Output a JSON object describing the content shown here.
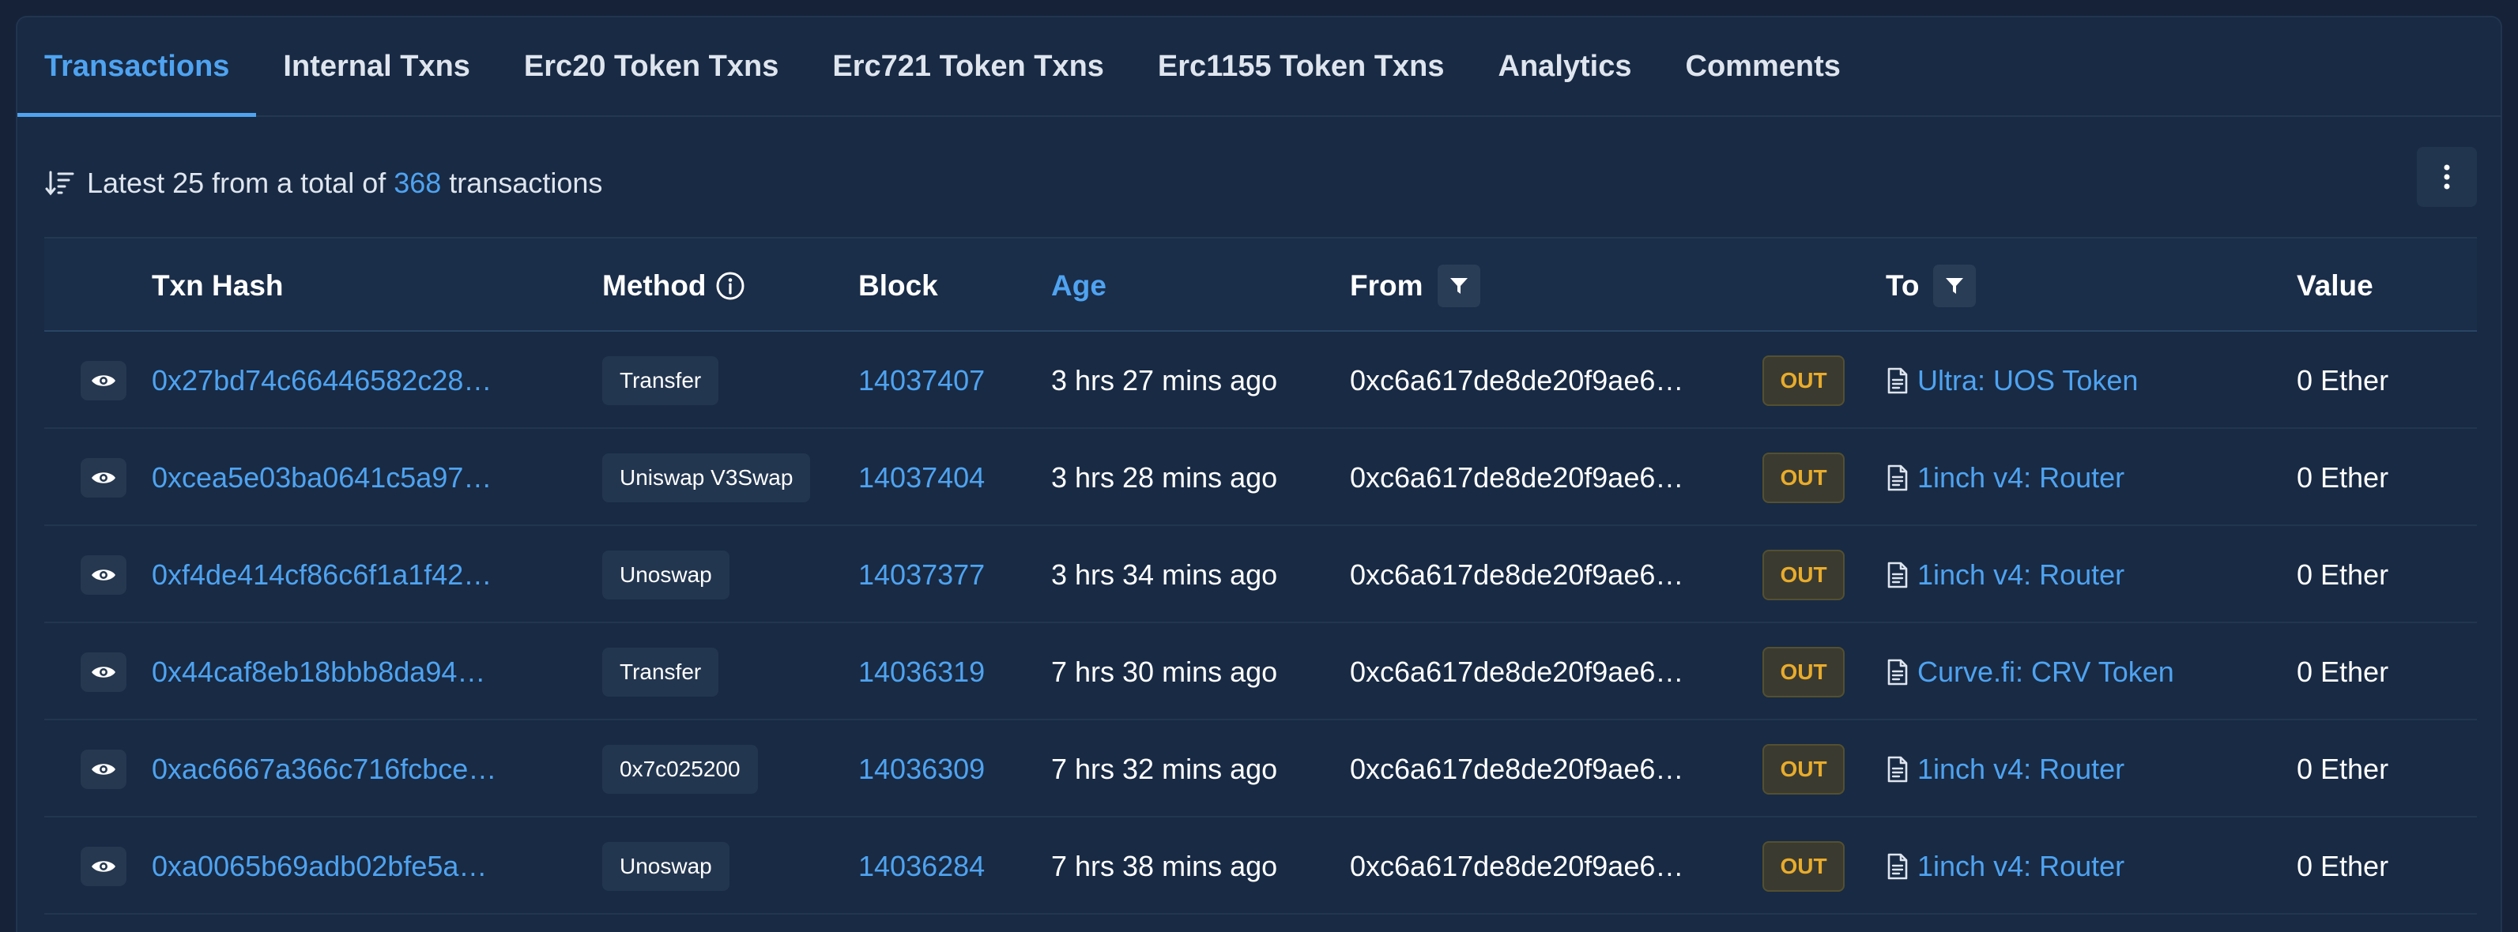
{
  "tabs": [
    {
      "label": "Transactions",
      "active": true
    },
    {
      "label": "Internal Txns"
    },
    {
      "label": "Erc20 Token Txns"
    },
    {
      "label": "Erc721 Token Txns"
    },
    {
      "label": "Erc1155 Token Txns"
    },
    {
      "label": "Analytics"
    },
    {
      "label": "Comments"
    }
  ],
  "summary": {
    "prefix": "Latest 25 from a total of",
    "count": "368",
    "suffix": "transactions"
  },
  "table": {
    "headers": {
      "txn_hash": "Txn Hash",
      "method": "Method",
      "block": "Block",
      "age": "Age",
      "from": "From",
      "to": "To",
      "value": "Value"
    },
    "rows": [
      {
        "hash": "0x27bd74c66446582c28…",
        "method": "Transfer",
        "block": "14037407",
        "age": "3 hrs 27 mins ago",
        "from": "0xc6a617de8de20f9ae6…",
        "direction": "OUT",
        "to": "Ultra: UOS Token",
        "value": "0 Ether"
      },
      {
        "hash": "0xcea5e03ba0641c5a97…",
        "method": "Uniswap V3Swap",
        "block": "14037404",
        "age": "3 hrs 28 mins ago",
        "from": "0xc6a617de8de20f9ae6…",
        "direction": "OUT",
        "to": "1inch v4: Router",
        "value": "0 Ether"
      },
      {
        "hash": "0xf4de414cf86c6f1a1f42…",
        "method": "Unoswap",
        "block": "14037377",
        "age": "3 hrs 34 mins ago",
        "from": "0xc6a617de8de20f9ae6…",
        "direction": "OUT",
        "to": "1inch v4: Router",
        "value": "0 Ether"
      },
      {
        "hash": "0x44caf8eb18bbb8da94…",
        "method": "Transfer",
        "block": "14036319",
        "age": "7 hrs 30 mins ago",
        "from": "0xc6a617de8de20f9ae6…",
        "direction": "OUT",
        "to": "Curve.fi: CRV Token",
        "value": "0 Ether"
      },
      {
        "hash": "0xac6667a366c716fcbce…",
        "method": "0x7c025200",
        "block": "14036309",
        "age": "7 hrs 32 mins ago",
        "from": "0xc6a617de8de20f9ae6…",
        "direction": "OUT",
        "to": "1inch v4: Router",
        "value": "0 Ether"
      },
      {
        "hash": "0xa0065b69adb02bfe5a…",
        "method": "Unoswap",
        "block": "14036284",
        "age": "7 hrs 38 mins ago",
        "from": "0xc6a617de8de20f9ae6…",
        "direction": "OUT",
        "to": "1inch v4: Router",
        "value": "0 Ether"
      }
    ]
  },
  "colors": {
    "background": "#152238",
    "panel": "#182a44",
    "accent": "#4fa3f0",
    "out_badge_text": "#e8ac2c"
  }
}
